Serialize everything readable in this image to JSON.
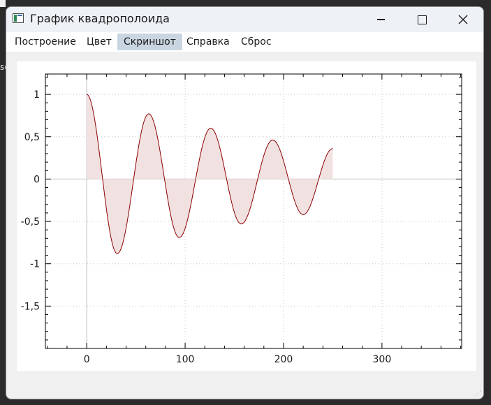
{
  "window": {
    "title": "График квадрополоида"
  },
  "menu": {
    "items": [
      {
        "label": "Построение",
        "active": false
      },
      {
        "label": "Цвет",
        "active": false
      },
      {
        "label": "Скриншот",
        "active": true
      },
      {
        "label": "Справка",
        "active": false
      },
      {
        "label": "Сброс",
        "active": false
      }
    ]
  },
  "colors": {
    "curve": "#8b0000",
    "fill": "#f2e1e1",
    "active_menu": "#c9d6e1"
  },
  "chart_data": {
    "type": "area",
    "function": "damped cosine",
    "x_range": [
      0,
      250
    ],
    "xlim": [
      -42,
      381
    ],
    "ylim": [
      -2.0,
      1.24
    ],
    "xticks": [
      0,
      100,
      200,
      300
    ],
    "xtick_labels": [
      "0",
      "100",
      "200",
      "300"
    ],
    "yticks": [
      1,
      0.5,
      0,
      -0.5,
      -1,
      -1.5
    ],
    "ytick_labels": [
      "1",
      "0,5",
      "0",
      "-0,5",
      "-1",
      "-1,5"
    ],
    "grid": true,
    "axis_lines_at_zero": true,
    "peaks": [
      {
        "x": 0,
        "y": 1.0
      },
      {
        "x": 31,
        "y": -0.88
      },
      {
        "x": 63,
        "y": 0.77
      },
      {
        "x": 94,
        "y": -0.69
      },
      {
        "x": 126,
        "y": 0.6
      },
      {
        "x": 157,
        "y": -0.53
      },
      {
        "x": 189,
        "y": 0.46
      },
      {
        "x": 220,
        "y": -0.42
      },
      {
        "x": 250,
        "y": 0.36
      }
    ],
    "title": "",
    "xlabel": "",
    "ylabel": ""
  }
}
